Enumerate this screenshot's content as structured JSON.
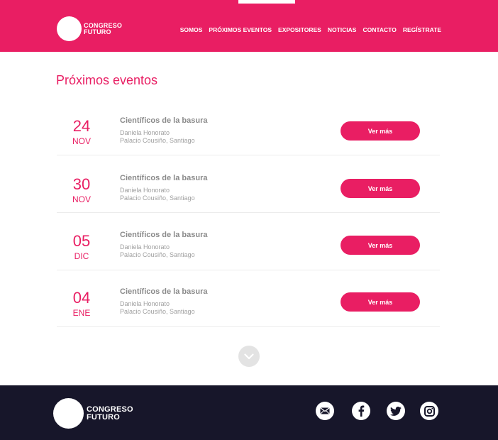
{
  "header": {
    "logo_line1": "CONGRESO",
    "logo_line2": "FUTURO",
    "nav": [
      "SOMOS",
      "PRÓXIMOS EVENTOS",
      "EXPOSITORES",
      "NOTICIAS",
      "CONTACTO",
      "REGÍSTRATE"
    ]
  },
  "main": {
    "title": "Próximos eventos",
    "events": [
      {
        "day": "24",
        "month": "NOV",
        "title": "Científicos de la basura",
        "speaker": "Daniela Honorato",
        "place": "Palacio Cousiño, Santiago",
        "button": "Ver más"
      },
      {
        "day": "30",
        "month": "NOV",
        "title": "Científicos de la basura",
        "speaker": "Daniela Honorato",
        "place": "Palacio Cousiño, Santiago",
        "button": "Ver más"
      },
      {
        "day": "05",
        "month": "DIC",
        "title": "Científicos de la basura",
        "speaker": "Daniela Honorato",
        "place": "Palacio Cousiño, Santiago",
        "button": "Ver más"
      },
      {
        "day": "04",
        "month": "ENE",
        "title": "Científicos de la basura",
        "speaker": "Daniela Honorato",
        "place": "Palacio Cousiño, Santiago",
        "button": "Ver más"
      }
    ],
    "more_icon": "chevron-down-icon"
  },
  "footer": {
    "logo_line1": "CONGRESO",
    "logo_line2": "FUTURO",
    "social": [
      "mail-icon",
      "facebook-icon",
      "twitter-icon",
      "instagram-icon"
    ]
  },
  "colors": {
    "accent": "#e91e63",
    "footer_bg": "#17162a",
    "muted_text": "#8a8a8a"
  }
}
